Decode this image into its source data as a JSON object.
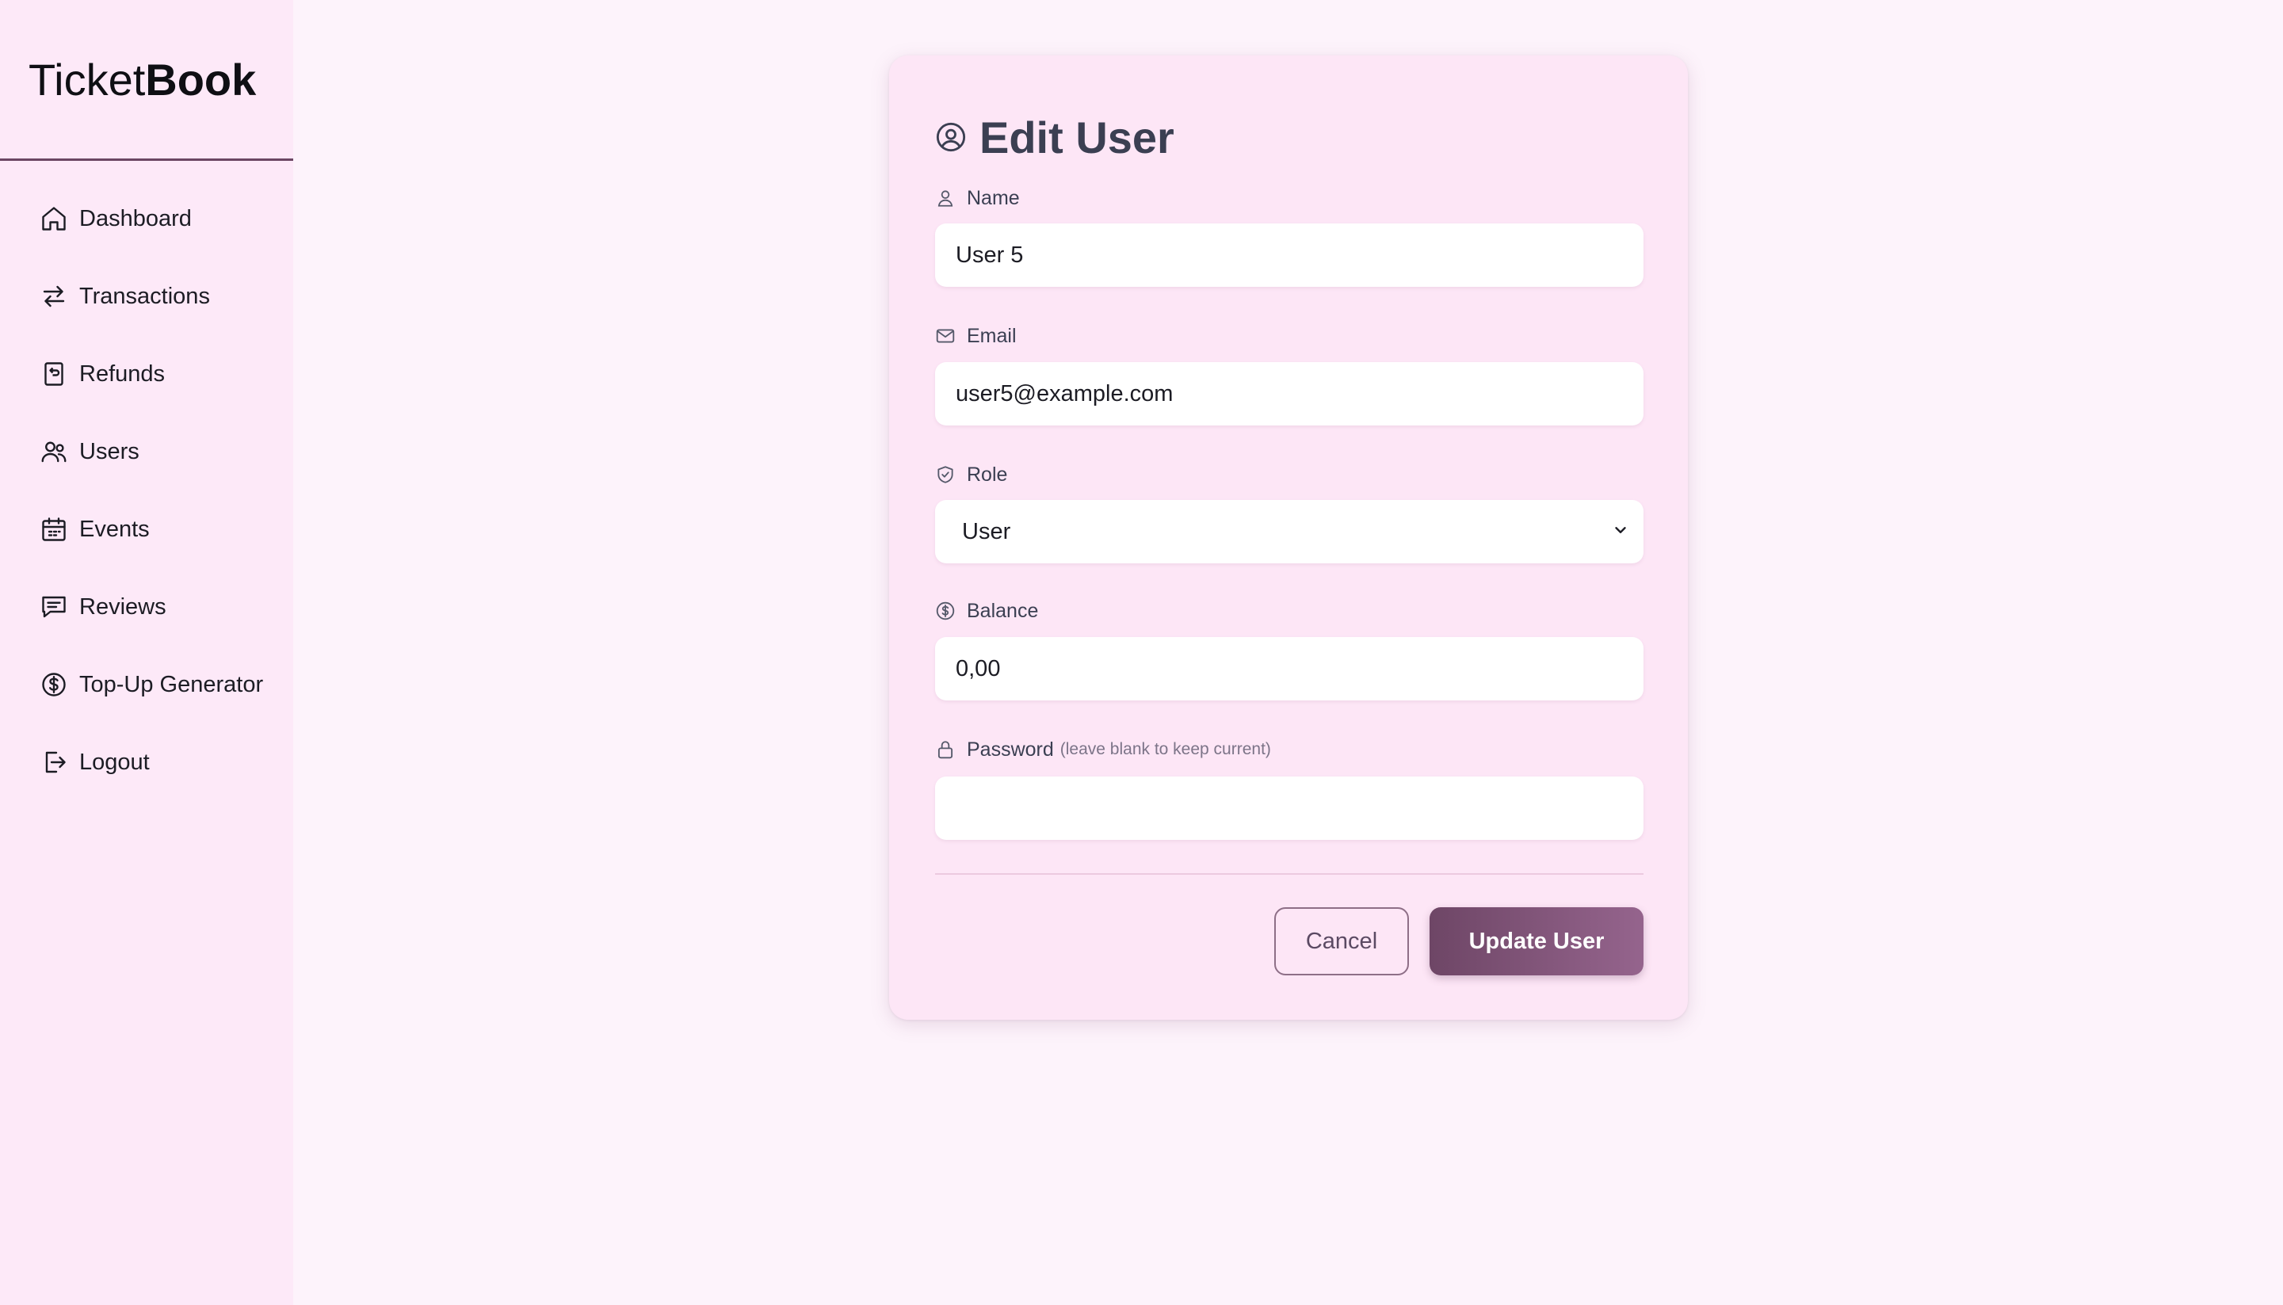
{
  "brand": {
    "light": "Ticket",
    "bold": "Book"
  },
  "sidebar": {
    "items": [
      {
        "label": "Dashboard",
        "icon": "home-icon"
      },
      {
        "label": "Transactions",
        "icon": "arrows-swap-icon"
      },
      {
        "label": "Refunds",
        "icon": "receipt-refund-icon"
      },
      {
        "label": "Users",
        "icon": "users-icon"
      },
      {
        "label": "Events",
        "icon": "calendar-icon"
      },
      {
        "label": "Reviews",
        "icon": "message-icon"
      },
      {
        "label": "Top-Up Generator",
        "icon": "dollar-circle-icon"
      },
      {
        "label": "Logout",
        "icon": "logout-icon"
      }
    ]
  },
  "form": {
    "title": "Edit User",
    "name": {
      "label": "Name",
      "value": "User 5"
    },
    "email": {
      "label": "Email",
      "value": "user5@example.com"
    },
    "role": {
      "label": "Role",
      "value": "User"
    },
    "balance": {
      "label": "Balance",
      "value": "0,00"
    },
    "password": {
      "label": "Password",
      "hint": "(leave blank to keep current)",
      "value": ""
    },
    "cancel_label": "Cancel",
    "update_label": "Update User"
  },
  "colors": {
    "background": "#fdf3fb",
    "sidebar": "#fde9f8",
    "card": "#fde6f6",
    "primary": "#6e4666"
  }
}
